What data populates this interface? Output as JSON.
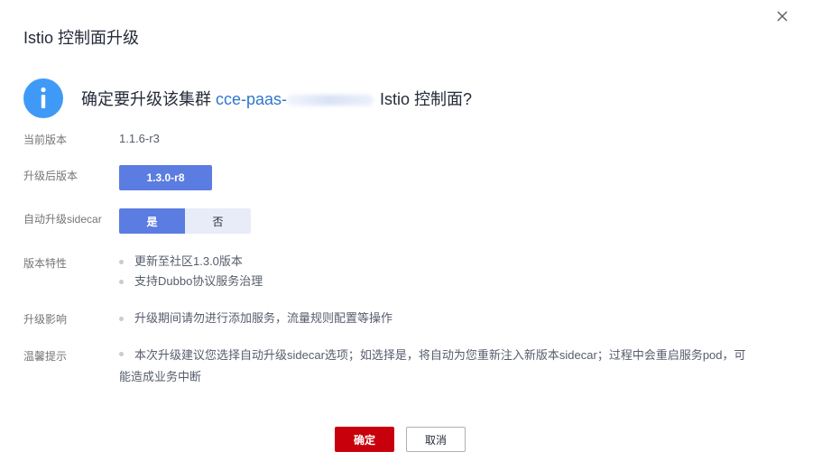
{
  "dialog": {
    "title": "Istio 控制面升级",
    "close_icon": "close-icon",
    "question_prefix": "确定要升级该集群 ",
    "cluster_name_visible": "cce-paas-",
    "question_suffix": " Istio 控制面?"
  },
  "fields": {
    "current_version_label": "当前版本",
    "current_version_value": "1.1.6-r3",
    "target_version_label": "升级后版本",
    "target_version_value": "1.3.0-r8",
    "auto_upgrade_label": "自动升级sidecar",
    "auto_upgrade_yes": "是",
    "auto_upgrade_no": "否",
    "features_label": "版本特性",
    "features": [
      "更新至社区1.3.0版本",
      "支持Dubbo协议服务治理"
    ],
    "impact_label": "升级影响",
    "impact": [
      "升级期间请勿进行添加服务，流量规则配置等操作"
    ],
    "tips_label": "温馨提示",
    "tips_text": "本次升级建议您选择自动升级sidecar选项；如选择是，将自动为您重新注入新版本sidecar；过程中会重启服务pod，可能造成业务中断"
  },
  "buttons": {
    "ok": "确定",
    "cancel": "取消"
  },
  "colors": {
    "primary": "#5b7ce0",
    "danger": "#c7000b",
    "info": "#3f9af7",
    "link": "#2f76cf"
  }
}
